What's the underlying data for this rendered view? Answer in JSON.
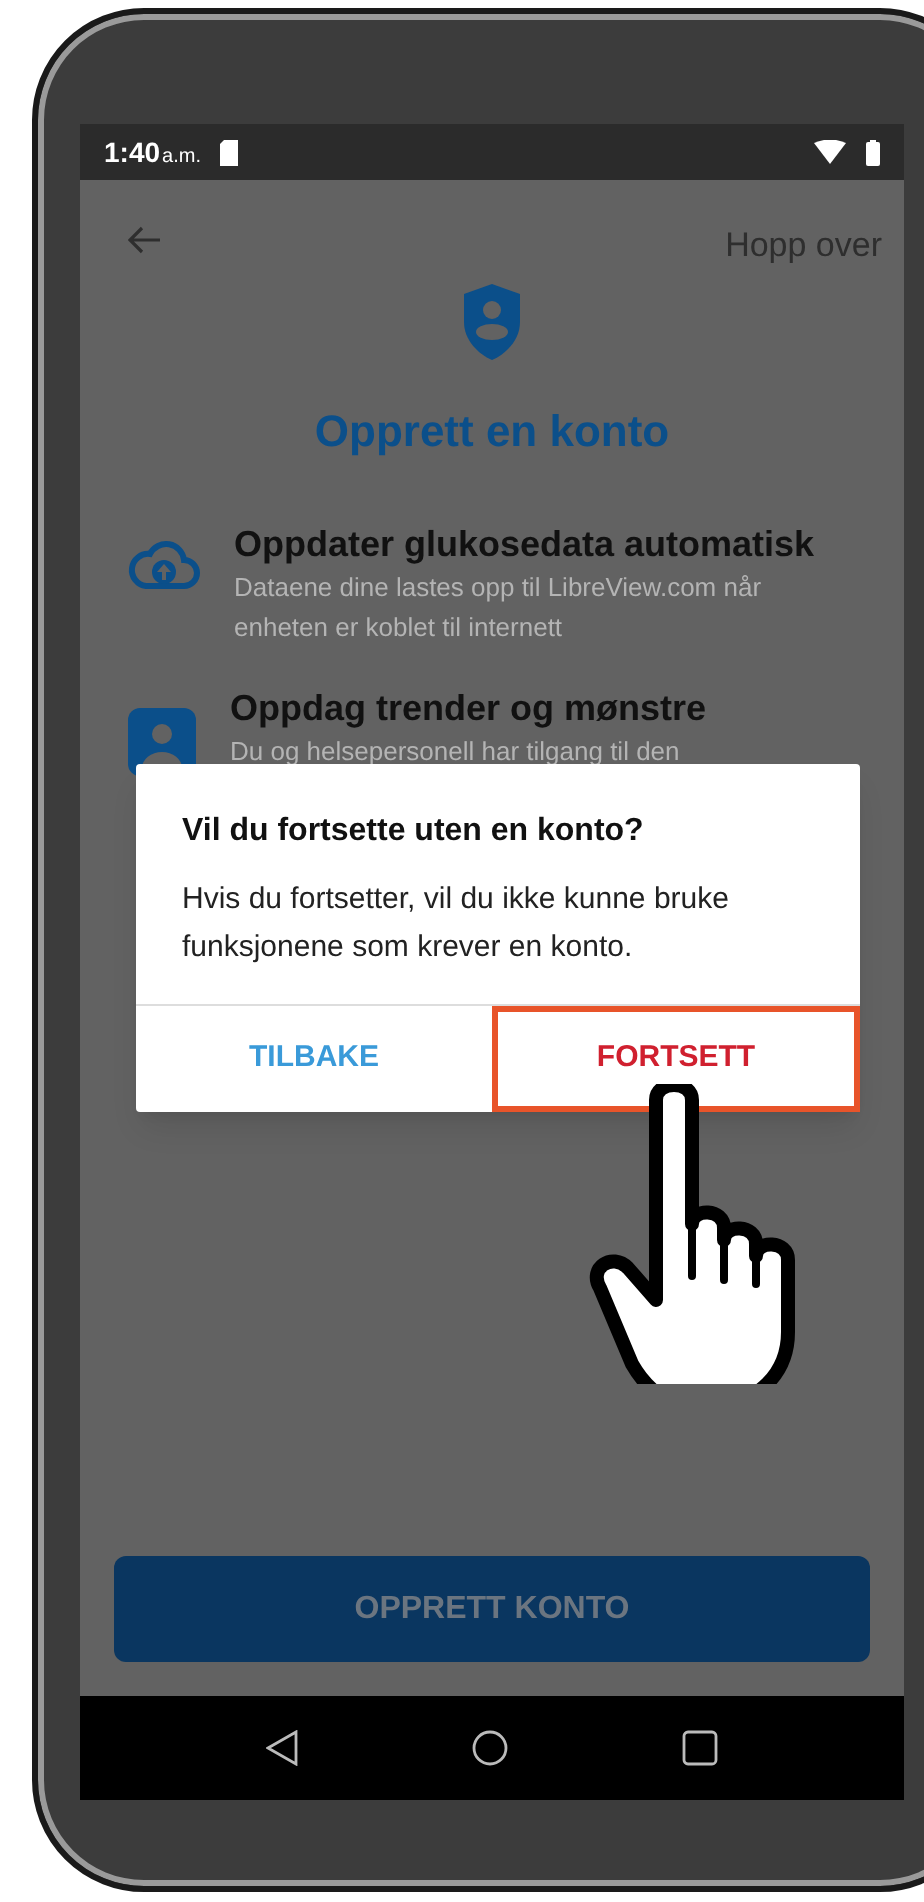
{
  "status_bar": {
    "time": "1:40",
    "ampm": "a.m."
  },
  "header": {
    "skip": "Hopp over"
  },
  "title": "Opprett en konto",
  "features": [
    {
      "heading": "Oppdater glukosedata automatisk",
      "description": "Dataene dine lastes opp til LibreView.com når enheten er koblet til internett"
    },
    {
      "heading": "Oppdag trender og mønstre",
      "description": "Du og helsepersonell har tilgang til den"
    }
  ],
  "dialog": {
    "title": "Vil du fortsette uten en konto?",
    "message": "Hvis du fortsetter, vil du ikke kunne bruke funksjonene som krever en konto.",
    "buttons": [
      {
        "label": "TILBAKE",
        "kind": "neutral",
        "highlighted": false
      },
      {
        "label": "FORTSETT",
        "kind": "confirm",
        "highlighted": true
      }
    ]
  },
  "primary_button": "OPPRETT KONTO"
}
